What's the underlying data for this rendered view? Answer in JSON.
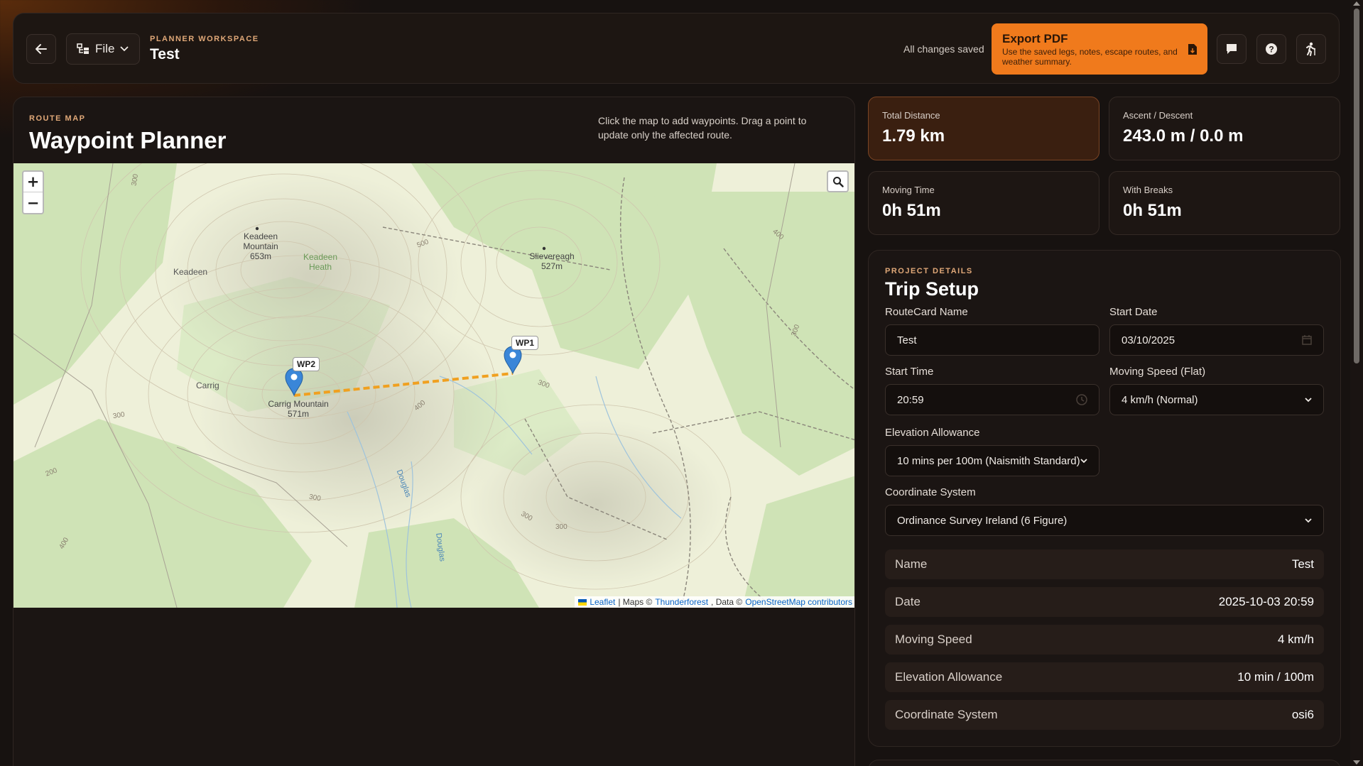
{
  "header": {
    "file_label": "File",
    "workspace_eyebrow": "PLANNER WORKSPACE",
    "workspace_title": "Test",
    "save_status": "All changes saved",
    "export": {
      "title": "Export PDF",
      "subtitle": "Use the saved legs, notes, escape routes, and weather summary."
    },
    "icons": [
      "back-arrow-icon",
      "file-tree-icon",
      "chevron-down-icon",
      "document-download-icon",
      "comment-icon",
      "help-icon",
      "hiker-icon"
    ]
  },
  "map_panel": {
    "eyebrow": "ROUTE MAP",
    "title": "Waypoint Planner",
    "hint": "Click the map to add waypoints. Drag a point to update only the affected route.",
    "zoom_in": "+",
    "zoom_out": "−",
    "attribution": {
      "leaflet": "Leaflet",
      "sep1": "| Maps ©",
      "thunderforest": "Thunderforest",
      "sep2": ", Data ©",
      "osm": "OpenStreetMap contributors"
    },
    "places": [
      {
        "name": "Keadeen",
        "sub": "Mountain",
        "elev": "653m"
      },
      {
        "name": "Keadeen",
        "sub": "Heath"
      },
      {
        "name": "Keadeen"
      },
      {
        "name": "Slievereagh",
        "elev": "527m"
      },
      {
        "name": "Carrig"
      },
      {
        "name": "Carrig Mountain",
        "elev": "571m"
      },
      {
        "name": "Douglas"
      },
      {
        "name": "Douglas"
      }
    ],
    "contours": [
      "300",
      "500",
      "400",
      "300",
      "400",
      "300",
      "300",
      "300",
      "300",
      "200",
      "300",
      "400"
    ],
    "waypoints": [
      {
        "label": "WP1"
      },
      {
        "label": "WP2"
      }
    ]
  },
  "stats": [
    {
      "label": "Total Distance",
      "value": "1.79 km"
    },
    {
      "label": "Ascent / Descent",
      "value": "243.0 m / 0.0 m"
    },
    {
      "label": "Moving Time",
      "value": "0h 51m"
    },
    {
      "label": "With Breaks",
      "value": "0h 51m"
    }
  ],
  "setup": {
    "eyebrow": "PROJECT DETAILS",
    "title": "Trip Setup",
    "routecard_name_label": "RouteCard Name",
    "routecard_name": "Test",
    "start_date_label": "Start Date",
    "start_date": "03/10/2025",
    "start_time_label": "Start Time",
    "start_time": "20:59",
    "speed_label": "Moving Speed (Flat)",
    "speed": "4 km/h (Normal)",
    "elevation_label": "Elevation Allowance",
    "elevation": "10 mins per 100m (Naismith Standard)",
    "coord_label": "Coordinate System",
    "coord": "Ordinance Survey Ireland (6 Figure)",
    "summary": [
      {
        "key": "Name",
        "value": "Test"
      },
      {
        "key": "Date",
        "value": "2025-10-03 20:59"
      },
      {
        "key": "Moving Speed",
        "value": "4 km/h"
      },
      {
        "key": "Elevation Allowance",
        "value": "10 min / 100m"
      },
      {
        "key": "Coordinate System",
        "value": "osi6"
      }
    ]
  },
  "colors": {
    "accent": "#f07a1c",
    "route_line": "#f0a020",
    "marker": "#3a86d8",
    "forest": "#cfe3b6"
  }
}
